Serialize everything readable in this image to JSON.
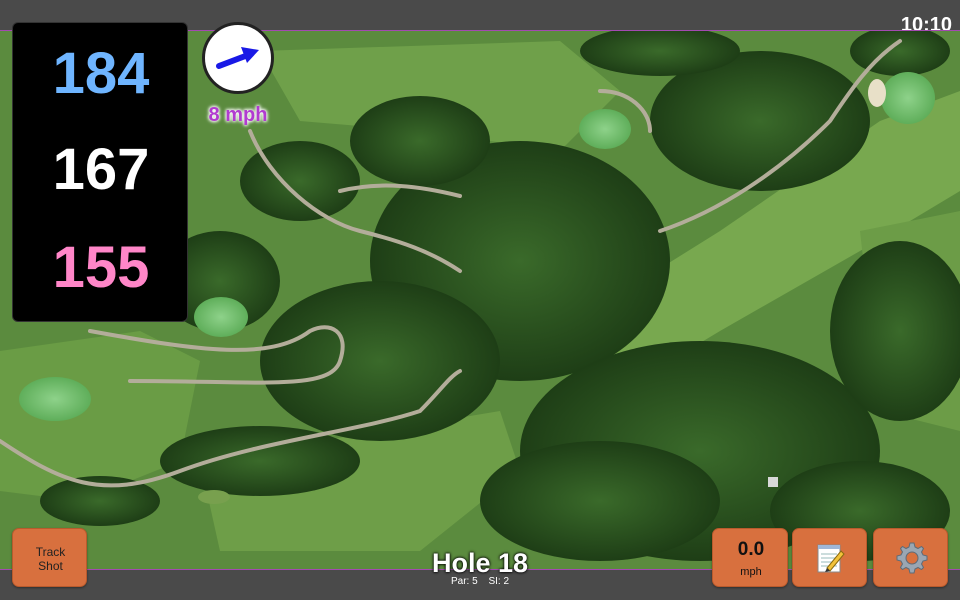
{
  "status_bar": {
    "time": "10:10"
  },
  "distances": {
    "back": "184",
    "middle": "167",
    "front": "155",
    "colors": {
      "back": "#6fb5ff",
      "middle": "#ffffff",
      "front": "#ff86c8"
    }
  },
  "wind": {
    "speed": "8 mph",
    "icon": "wind-direction-arrow-icon",
    "arrow_color": "#1919e6",
    "label_color": "#b13bd0"
  },
  "hole": {
    "title": "Hole 18",
    "par": "Par: 5",
    "stroke_index": "SI: 2"
  },
  "buttons": {
    "track_shot": "Track\nShot",
    "speed_value": "0.0",
    "speed_unit": "mph",
    "notes_icon": "notepad-icon",
    "settings_icon": "gear-icon",
    "accent": "#d8703e"
  },
  "map": {
    "type": "satellite-aerial-golf-course"
  }
}
